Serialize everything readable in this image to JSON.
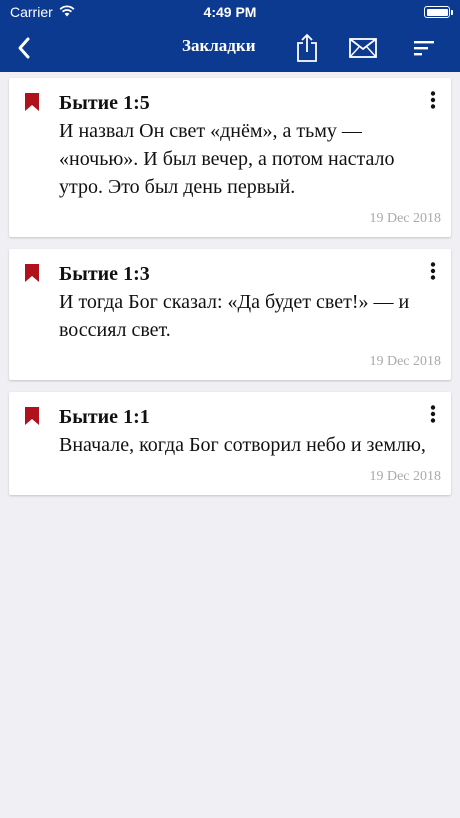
{
  "status_bar": {
    "carrier": "Carrier",
    "time": "4:49 PM",
    "wifi_icon": "wifi-icon",
    "battery_level": 1.0
  },
  "nav": {
    "title": "Закладки",
    "icons": [
      "back-chevron-icon",
      "share-icon",
      "mail-icon",
      "sort-icon"
    ]
  },
  "colors": {
    "nav_background": "#0d3a91",
    "bookmark_red": "#b0121b",
    "page_background": "#efeff4"
  },
  "bookmarks": [
    {
      "reference": "Бытие 1:5",
      "text": "И назвал Он свет «днём», а тьму — «ночью». И был вечер, а потом настало утро. Это был день первый.",
      "date": "19 Dec 2018"
    },
    {
      "reference": "Бытие 1:3",
      "text": "И тогда Бог сказал: «Да будет свет!» — и воссиял свет.",
      "date": "19 Dec 2018"
    },
    {
      "reference": "Бытие 1:1",
      "text": "Вначале, когда Бог сотворил небо и землю,",
      "date": "19 Dec 2018"
    }
  ]
}
